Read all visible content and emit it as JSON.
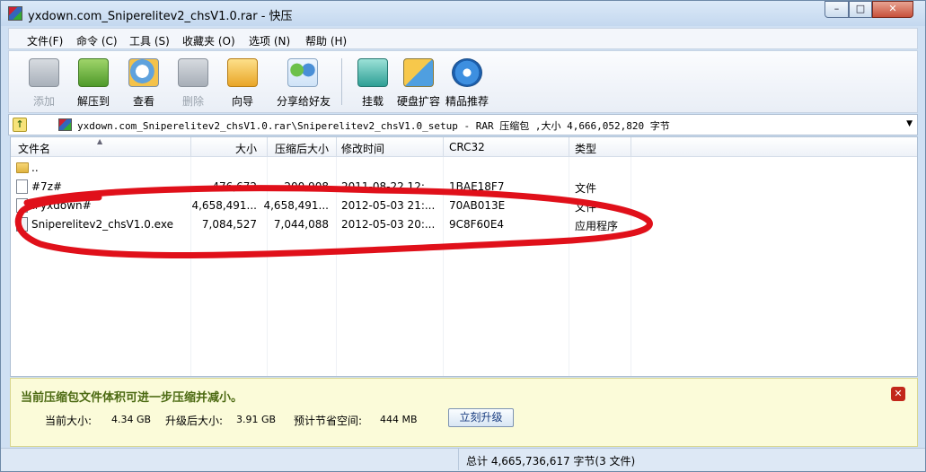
{
  "window": {
    "title": "yxdown.com_Sniperelitev2_chsV1.0.rar - 快压",
    "min_glyph": "–",
    "max_glyph": "□",
    "close_glyph": "✕"
  },
  "menu": [
    "文件(F)",
    "命令 (C)",
    "工具 (S)",
    "收藏夹 (O)",
    "选项 (N)",
    "帮助 (H)"
  ],
  "toolbar": [
    {
      "label": "添加",
      "icon": "add-icon",
      "disabled": true
    },
    {
      "label": "解压到",
      "icon": "extract-icon",
      "disabled": false
    },
    {
      "label": "查看",
      "icon": "view-icon",
      "disabled": false
    },
    {
      "label": "删除",
      "icon": "delete-icon",
      "disabled": true
    },
    {
      "label": "向导",
      "icon": "wizard-icon",
      "disabled": false
    },
    {
      "label": "分享给好友",
      "icon": "share-icon",
      "disabled": false
    },
    {
      "label": "挂载",
      "icon": "mount-icon",
      "disabled": false
    },
    {
      "label": "硬盘扩容",
      "icon": "disk-expand-icon",
      "disabled": false
    },
    {
      "label": "精品推荐",
      "icon": "recommend-icon",
      "disabled": false
    }
  ],
  "path": {
    "text": "yxdown.com_Sniperelitev2_chsV1.0.rar\\Sniperelitev2_chsV1.0_setup - RAR 压缩包 ,大小 4,666,052,820 字节"
  },
  "columns": [
    "文件名",
    "大小",
    "压缩后大小",
    "修改时间",
    "CRC32",
    "类型"
  ],
  "files": [
    {
      "name": "..",
      "size": "",
      "packed": "",
      "modified": "",
      "crc": "",
      "type": "",
      "kind": "folder"
    },
    {
      "name": "#7z#",
      "size": "476,672",
      "packed": "200,908",
      "modified": "2011-08-22   12:...",
      "crc": "1BAE18F7",
      "type": "文件",
      "kind": "file"
    },
    {
      "name": "#yxdown#",
      "size": "4,658,491...",
      "packed": "4,658,491...",
      "modified": "2012-05-03   21:...",
      "crc": "70AB013E",
      "type": "文件",
      "kind": "file"
    },
    {
      "name": "Sniperelitev2_chsV1.0.exe",
      "size": "7,084,527",
      "packed": "7,044,088",
      "modified": "2012-05-03   20:...",
      "crc": "9C8F60E4",
      "type": "应用程序",
      "kind": "exe"
    }
  ],
  "notice": {
    "title": "当前压缩包文件体积可进一步压缩并减小。",
    "current_label": "当前大小:",
    "current_value": "4.34 GB",
    "after_label": "升级后大小:",
    "after_value": "3.91 GB",
    "saving_label": "预计节省空间:",
    "saving_value": "444 MB",
    "button": "立刻升级",
    "close_glyph": "✕"
  },
  "status": {
    "text": "总计  4,665,736,617 字节(3 文件)"
  },
  "colors": {
    "annotation": "#e0101a",
    "notice_title": "#4c6a12"
  }
}
